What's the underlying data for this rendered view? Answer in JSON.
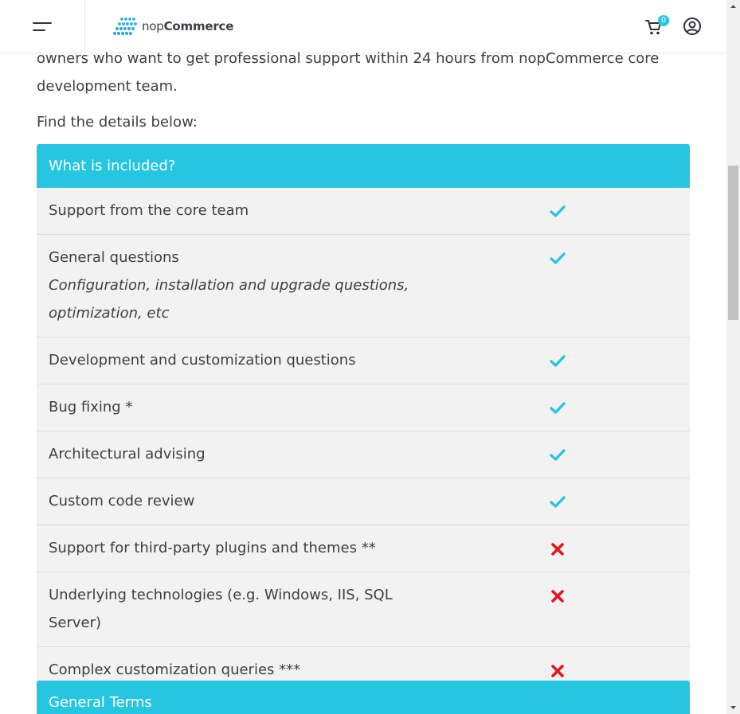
{
  "header": {
    "logo_prefix": "nop",
    "logo_bold": "Commerce",
    "cart_count": "0"
  },
  "intro": {
    "line1": "owners who want to get professional support within 24 hours from nopCommerce core",
    "line2": "development team.",
    "find": "Find the details below:"
  },
  "table": {
    "heading": "What is included?",
    "rows": [
      {
        "label": "Support from the core team",
        "sub": "",
        "included": true
      },
      {
        "label": "General questions",
        "sub": "Configuration, installation and upgrade questions, optimization, etc",
        "included": true
      },
      {
        "label": "Development and customization questions",
        "sub": "",
        "included": true
      },
      {
        "label": "Bug fixing *",
        "sub": "",
        "included": true
      },
      {
        "label": "Architectural advising",
        "sub": "",
        "included": true
      },
      {
        "label": "Custom code review",
        "sub": "",
        "included": true
      },
      {
        "label": "Support for third-party plugins and themes **",
        "sub": "",
        "included": false
      },
      {
        "label": "Underlying technologies (e.g. Windows, IIS, SQL Server)",
        "sub": "",
        "included": false
      },
      {
        "label": "Complex customization queries ***",
        "sub": "",
        "included": false
      }
    ],
    "next_heading": "General Terms"
  },
  "colors": {
    "accent": "#26c6e0",
    "check": "#26c6e0",
    "cross": "#e8141f",
    "row_bg": "#f2f2f2"
  },
  "icons": {
    "menu": "hamburger-icon",
    "cart": "cart-icon",
    "account": "user-circle-icon",
    "included": "check-icon",
    "excluded": "cross-icon"
  }
}
